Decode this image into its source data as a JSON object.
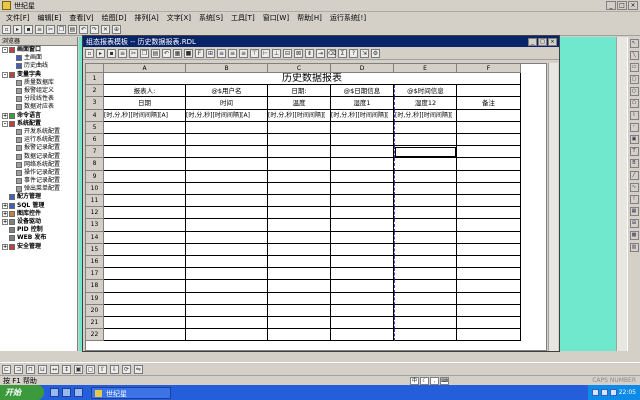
{
  "app": {
    "title": "世纪星"
  },
  "menu": [
    "文件[F]",
    "编辑[E]",
    "查看[V]",
    "绘图[D]",
    "排列[A]",
    "文字[X]",
    "系统[S]",
    "工具[T]",
    "窗口[W]",
    "帮助[H]",
    "运行系统[!]"
  ],
  "tree": {
    "header": "浏览器",
    "nodes": [
      {
        "label": "画面窗口",
        "level": 0,
        "expander": "-",
        "bold": true,
        "color": "#c04040"
      },
      {
        "label": "主画面",
        "level": 1,
        "bold": false,
        "color": "#4060c0"
      },
      {
        "label": "历史曲线",
        "level": 1,
        "bold": false,
        "color": "#4060c0"
      },
      {
        "label": "变量字典",
        "level": 0,
        "expander": "-",
        "bold": true,
        "color": "#c04040"
      },
      {
        "label": "质量数据库",
        "level": 1,
        "bold": false,
        "color": "#a0a0a0"
      },
      {
        "label": "报警组定义",
        "level": 1,
        "bold": false,
        "color": "#a0a0a0"
      },
      {
        "label": "分段线性表",
        "level": 1,
        "bold": false,
        "color": "#a0a0a0"
      },
      {
        "label": "数据对应表",
        "level": 1,
        "bold": false,
        "color": "#a0a0a0"
      },
      {
        "label": "命令语言",
        "level": 0,
        "expander": "+",
        "bold": true,
        "color": "#40a040"
      },
      {
        "label": "系统配置",
        "level": 0,
        "expander": "-",
        "bold": true,
        "color": "#c04040"
      },
      {
        "label": "开发系统配置",
        "level": 1,
        "bold": false,
        "color": "#a0a0a0"
      },
      {
        "label": "运行系统配置",
        "level": 1,
        "bold": false,
        "color": "#a0a0a0"
      },
      {
        "label": "报警记录配置",
        "level": 1,
        "bold": false,
        "color": "#a0a0a0"
      },
      {
        "label": "数据记录配置",
        "level": 1,
        "bold": false,
        "color": "#a0a0a0"
      },
      {
        "label": "网络系统配置",
        "level": 1,
        "bold": false,
        "color": "#a0a0a0"
      },
      {
        "label": "操作记录配置",
        "level": 1,
        "bold": false,
        "color": "#a0a0a0"
      },
      {
        "label": "事件记录配置",
        "level": 1,
        "bold": false,
        "color": "#a0a0a0"
      },
      {
        "label": "弹出菜单配置",
        "level": 1,
        "bold": false,
        "color": "#a0a0a0"
      },
      {
        "label": "配方管理",
        "level": 0,
        "expander": "",
        "bold": true,
        "color": "#4060c0"
      },
      {
        "label": "SQL 管理",
        "level": 0,
        "expander": "+",
        "bold": true,
        "color": "#4060c0"
      },
      {
        "label": "图库控件",
        "level": 0,
        "expander": "+",
        "bold": true,
        "color": "#c08040"
      },
      {
        "label": "设备驱动",
        "level": 0,
        "expander": "+",
        "bold": true,
        "color": "#808080"
      },
      {
        "label": "PID 控制",
        "level": 0,
        "expander": "",
        "bold": true,
        "color": "#808080"
      },
      {
        "label": "WEB 发布",
        "level": 0,
        "expander": "",
        "bold": true,
        "color": "#808080"
      },
      {
        "label": "安全管理",
        "level": 0,
        "expander": "+",
        "bold": true,
        "color": "#c04040"
      }
    ]
  },
  "report_window": {
    "title": "组态报表模板 -- 历史数据报表.RDL"
  },
  "sheet": {
    "columns": [
      "A",
      "B",
      "C",
      "D",
      "E",
      "F"
    ],
    "rows": [
      "1",
      "2",
      "3",
      "4",
      "5",
      "6",
      "7",
      "8",
      "9",
      "10",
      "11",
      "12",
      "13",
      "14",
      "15",
      "16",
      "17",
      "18",
      "19",
      "20",
      "21",
      "22"
    ],
    "report_title": "历史数据报表",
    "row2": [
      "报表人:",
      "@$用户名",
      "日期:",
      "@$日期信息",
      "@$时间信息",
      ""
    ],
    "row3": [
      "日期",
      "时间",
      "温度",
      "湿度1",
      "湿度12",
      "备注"
    ],
    "row4": [
      "[时,分,秒][时间间隔][A]",
      "[时,分,秒][时间间隔][A]",
      "[时,分,秒][时间间隔][",
      "[时,分,秒][时间间隔][",
      "[时,分,秒][时间间隔][",
      ""
    ]
  },
  "status": {
    "text": "按 F1 帮助",
    "caps": "CAPS NUMBER"
  },
  "taskbar": {
    "start": "开始",
    "app_button": "世纪星",
    "time": "22:05"
  }
}
